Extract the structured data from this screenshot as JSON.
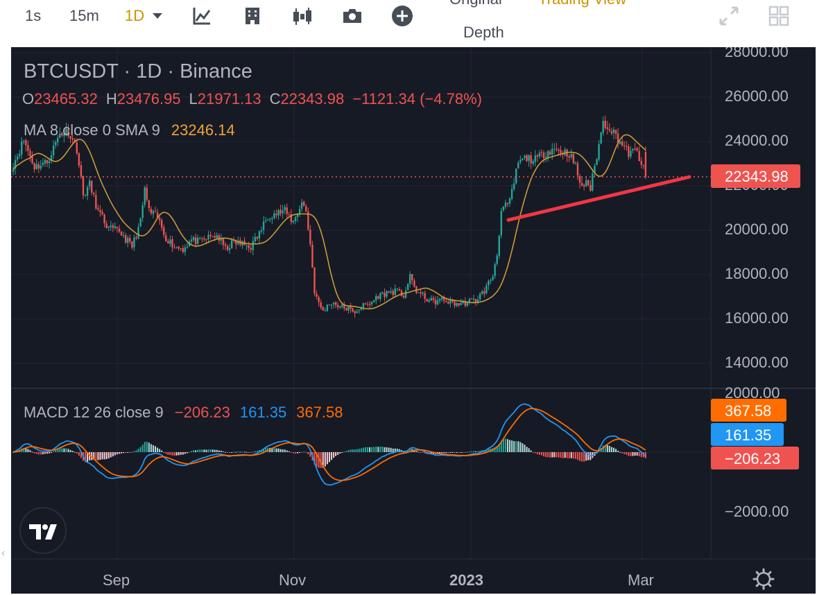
{
  "toolbar": {
    "intervals": [
      "1s",
      "15m",
      "1D"
    ],
    "active_interval": "1D",
    "views": {
      "original": "Original",
      "tradingview": "Trading View",
      "depth": "Depth"
    }
  },
  "legend": {
    "symbol": "BTCUSDT",
    "sep1": " · ",
    "interval": "1D",
    "sep2": " · ",
    "exchange": "Binance",
    "o_label": "O",
    "o": "23465.32",
    "h_label": "H",
    "h": "23476.95",
    "l_label": "L",
    "l": "21971.13",
    "c_label": "C",
    "c": "22343.98",
    "change": "−1121.34 (−4.78%)",
    "ma_label": "MA 8 close 0 SMA 9",
    "ma_value": "23246.14"
  },
  "macd_legend": {
    "label": "MACD 12 26 close 9",
    "hist": "−206.23",
    "macd": "161.35",
    "signal": "367.58"
  },
  "price_axis": {
    "ticks": [
      "28000.00",
      "26000.00",
      "24000.00",
      "22000.00",
      "20000.00",
      "18000.00",
      "16000.00",
      "14000.00",
      "2000.00"
    ],
    "last_price": "22343.98"
  },
  "macd_axis": {
    "ticks": [
      "−2000.00"
    ],
    "badges": {
      "signal": "367.58",
      "macd": "161.35",
      "hist": "−206.23"
    }
  },
  "time_axis": {
    "labels": [
      "Sep",
      "Nov",
      "2023",
      "Mar"
    ]
  },
  "colors": {
    "up": "#26a69a",
    "down": "#ef5350",
    "ma": "#c99a3a",
    "macd": "#2196f3",
    "signal": "#ff6d00",
    "trendline": "#f23645",
    "background": "#161a25",
    "grid": "#242733",
    "axis_text": "#b2b5be"
  },
  "icons": [
    "indicator-icon",
    "building-icon",
    "candles-icon",
    "camera-icon",
    "add-icon",
    "fullscreen-icon",
    "grid-layout-icon",
    "tradingview-logo-icon",
    "settings-gear-icon"
  ],
  "chart_data": {
    "type": "candlestick",
    "symbol": "BTCUSDT",
    "interval": "1D",
    "x_labels": [
      "Sep",
      "Nov",
      "2023",
      "Mar"
    ],
    "yticks": [
      14000,
      16000,
      18000,
      20000,
      22000,
      24000,
      26000,
      28000
    ],
    "last": 22343.98,
    "anchors_close": [
      [
        0,
        22900
      ],
      [
        5,
        24000
      ],
      [
        10,
        22800
      ],
      [
        16,
        23000
      ],
      [
        22,
        24300
      ],
      [
        26,
        24400
      ],
      [
        30,
        23600
      ],
      [
        33,
        21500
      ],
      [
        36,
        22000
      ],
      [
        40,
        20800
      ],
      [
        45,
        20000
      ],
      [
        50,
        19900
      ],
      [
        56,
        19200
      ],
      [
        60,
        20300
      ],
      [
        62,
        21800
      ],
      [
        64,
        20800
      ],
      [
        68,
        20500
      ],
      [
        72,
        19600
      ],
      [
        76,
        19200
      ],
      [
        80,
        19100
      ],
      [
        84,
        19500
      ],
      [
        88,
        19400
      ],
      [
        92,
        19600
      ],
      [
        96,
        19700
      ],
      [
        100,
        19100
      ],
      [
        104,
        19400
      ],
      [
        108,
        19300
      ],
      [
        112,
        19200
      ],
      [
        116,
        19800
      ],
      [
        120,
        20600
      ],
      [
        124,
        20700
      ],
      [
        128,
        20800
      ],
      [
        132,
        20300
      ],
      [
        136,
        21200
      ],
      [
        138,
        20800
      ],
      [
        140,
        19300
      ],
      [
        142,
        17200
      ],
      [
        144,
        16600
      ],
      [
        146,
        16300
      ],
      [
        150,
        16700
      ],
      [
        154,
        16500
      ],
      [
        158,
        16400
      ],
      [
        160,
        16200
      ],
      [
        164,
        16500
      ],
      [
        168,
        16600
      ],
      [
        172,
        17000
      ],
      [
        176,
        17100
      ],
      [
        180,
        17200
      ],
      [
        184,
        17000
      ],
      [
        187,
        17800
      ],
      [
        190,
        17200
      ],
      [
        194,
        16900
      ],
      [
        198,
        16700
      ],
      [
        202,
        16800
      ],
      [
        206,
        16700
      ],
      [
        210,
        16600
      ],
      [
        214,
        16700
      ],
      [
        218,
        16800
      ],
      [
        222,
        17200
      ],
      [
        226,
        17900
      ],
      [
        228,
        18900
      ],
      [
        230,
        20800
      ],
      [
        234,
        21200
      ],
      [
        238,
        23000
      ],
      [
        242,
        23200
      ],
      [
        246,
        23100
      ],
      [
        250,
        23400
      ],
      [
        254,
        23600
      ],
      [
        258,
        23500
      ],
      [
        262,
        23400
      ],
      [
        265,
        22800
      ],
      [
        268,
        21800
      ],
      [
        270,
        22200
      ],
      [
        272,
        21800
      ],
      [
        276,
        23800
      ],
      [
        278,
        24800
      ],
      [
        281,
        24600
      ],
      [
        284,
        24200
      ],
      [
        287,
        23800
      ],
      [
        290,
        23400
      ],
      [
        294,
        23500
      ],
      [
        298,
        22344
      ]
    ],
    "macd_hist_last": -206.23,
    "macd_last": 161.35,
    "signal_last": 367.58,
    "macd_ytick": -2000,
    "trendline": {
      "from_price": 20400,
      "to_price": 22340
    },
    "ma": {
      "type": "SMA",
      "length": 8,
      "smoothing": 9,
      "last": 23246.14
    }
  }
}
